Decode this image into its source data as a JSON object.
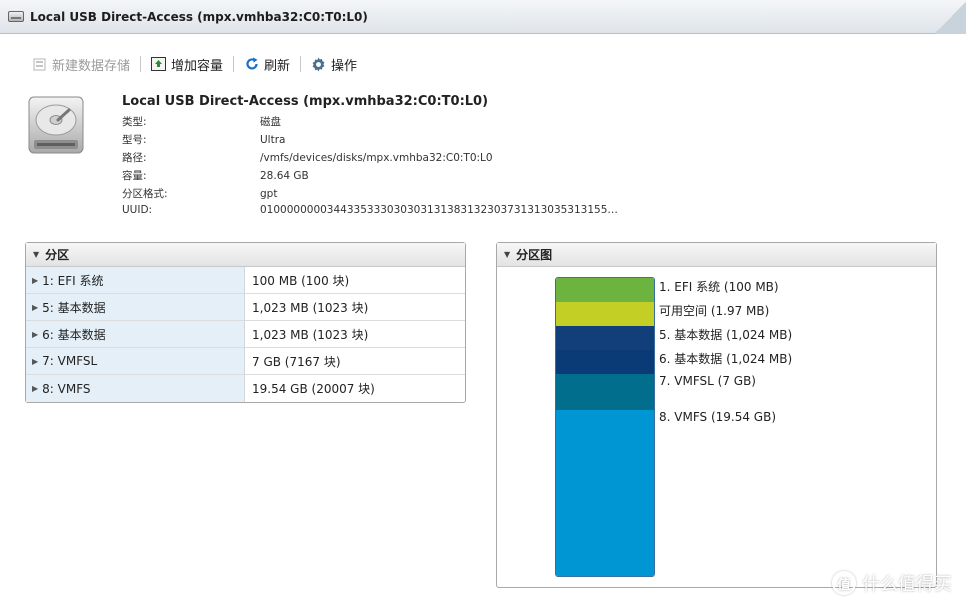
{
  "window": {
    "title": "Local USB Direct-Access (mpx.vmhba32:C0:T0:L0)"
  },
  "toolbar": {
    "new_datastore": "新建数据存储",
    "increase_capacity": "增加容量",
    "refresh": "刷新",
    "actions": "操作"
  },
  "device": {
    "title": "Local USB Direct-Access (mpx.vmhba32:C0:T0:L0)",
    "props": [
      {
        "key": "类型:",
        "value": "磁盘"
      },
      {
        "key": "型号:",
        "value": "Ultra"
      },
      {
        "key": "路径:",
        "value": "/vmfs/devices/disks/mpx.vmhba32:C0:T0:L0"
      },
      {
        "key": "容量:",
        "value": "28.64 GB"
      },
      {
        "key": "分区格式:",
        "value": "gpt"
      },
      {
        "key": "UUID:",
        "value": "0100000000344335333030303131383132303731313035313155…"
      }
    ]
  },
  "partitions": {
    "title": "分区",
    "rows": [
      {
        "name": "1: EFI 系统",
        "size": "100 MB (100 块)"
      },
      {
        "name": "5: 基本数据",
        "size": "1,023 MB (1023 块)"
      },
      {
        "name": "6: 基本数据",
        "size": "1,023 MB (1023 块)"
      },
      {
        "name": "7: VMFSL",
        "size": "7 GB (7167 块)"
      },
      {
        "name": "8: VMFS",
        "size": "19.54 GB (20007 块)"
      }
    ]
  },
  "partition_map": {
    "title": "分区图",
    "segments": [
      {
        "label": "1. EFI 系统  (100 MB)",
        "color": "#6db33f"
      },
      {
        "label": "可用空间  (1.97 MB)",
        "color": "#c3cf24"
      },
      {
        "label": "5. 基本数据  (1,024 MB)",
        "color": "#123f7a"
      },
      {
        "label": "6. 基本数据  (1,024 MB)",
        "color": "#0a3b77"
      },
      {
        "label": "7. VMFSL  (7 GB)",
        "color": "#006e8c"
      },
      {
        "label": "8. VMFS  (19.54 GB)",
        "color": "#0095d3"
      }
    ]
  },
  "watermark": {
    "icon_text": "值",
    "text": "什么值得买"
  }
}
